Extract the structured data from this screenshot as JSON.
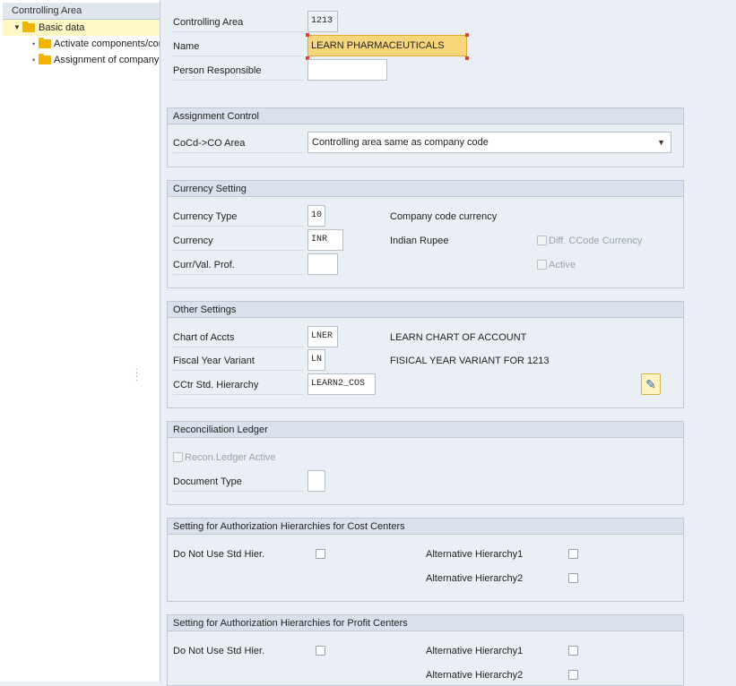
{
  "tree": {
    "header": "Controlling Area",
    "items": [
      {
        "label": "Basic data",
        "level": 0,
        "selected": true,
        "expanded": true
      },
      {
        "label": "Activate components/cor",
        "level": 1
      },
      {
        "label": "Assignment of company c",
        "level": 1
      }
    ]
  },
  "header_fields": {
    "controlling_area": {
      "label": "Controlling Area",
      "value": "1213"
    },
    "name": {
      "label": "Name",
      "value": "LEARN PHARMACEUTICALS"
    },
    "person_responsible": {
      "label": "Person Responsible",
      "value": ""
    }
  },
  "assignment_control": {
    "title": "Assignment Control",
    "cocd_label": "CoCd->CO Area",
    "cocd_value": "Controlling area same as company code"
  },
  "currency_setting": {
    "title": "Currency Setting",
    "currency_type_label": "Currency Type",
    "currency_type_value": "10",
    "currency_type_desc": "Company code currency",
    "currency_label": "Currency",
    "currency_value": "INR",
    "currency_desc": "Indian Rupee",
    "diff_ccode_label": "Diff. CCode Currency",
    "curr_val_prof_label": "Curr/Val. Prof.",
    "curr_val_prof_value": "",
    "active_label": "Active"
  },
  "other_settings": {
    "title": "Other Settings",
    "chart_label": "Chart of Accts",
    "chart_value": "LNER",
    "chart_desc": "LEARN CHART OF ACCOUNT",
    "fyv_label": "Fiscal Year Variant",
    "fyv_value": "LN",
    "fyv_desc": "FISICAL YEAR VARIANT FOR 1213",
    "cctr_label": "CCtr Std. Hierarchy",
    "cctr_value": "LEARN2_COS"
  },
  "reconciliation": {
    "title": "Reconciliation Ledger",
    "recon_active_label": "Recon.Ledger Active",
    "doc_type_label": "Document Type",
    "doc_type_value": ""
  },
  "auth_cost": {
    "title": "Setting for Authorization Hierarchies for Cost Centers",
    "no_std_label": "Do Not Use Std Hier.",
    "alt1_label": "Alternative Hierarchy1",
    "alt2_label": "Alternative Hierarchy2"
  },
  "auth_profit": {
    "title": "Setting for Authorization Hierarchies for Profit Centers",
    "no_std_label": "Do Not Use Std Hier.",
    "alt1_label": "Alternative Hierarchy1",
    "alt2_label": "Alternative Hierarchy2"
  }
}
